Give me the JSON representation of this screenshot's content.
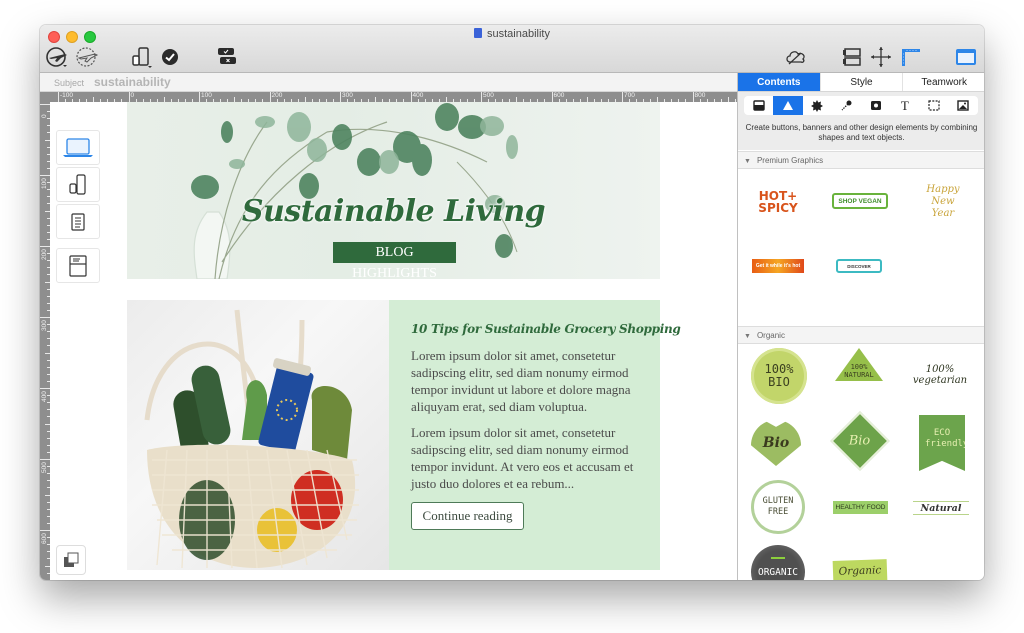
{
  "window": {
    "title": "sustainability",
    "title_icon": "document-icon"
  },
  "toolbar": {
    "left_icons": [
      "publish-icon",
      "publish-preview-icon",
      "device-preview-icon",
      "check-icon",
      "approval-icon"
    ],
    "right_icons": [
      "cloud-icon",
      "layout-icon",
      "move-arrows-icon",
      "ruler-icon",
      "sidebar-toggle-icon"
    ]
  },
  "subject": {
    "label": "Subject",
    "value": "sustainability"
  },
  "ruler": {
    "horizontal_labels": [
      "-100",
      "0",
      "100",
      "200",
      "300",
      "400",
      "500",
      "600",
      "700",
      "800"
    ],
    "vertical_labels": [
      "0",
      "100",
      "200",
      "300",
      "400",
      "500",
      "600"
    ]
  },
  "device_buttons": [
    {
      "name": "desktop",
      "icon": "laptop-icon"
    },
    {
      "name": "mobile",
      "icon": "phone-watch-icon"
    },
    {
      "name": "plain-text",
      "icon": "text-document-icon"
    },
    {
      "name": "email-header",
      "icon": "email-window-icon"
    }
  ],
  "banner": {
    "title": "Sustainable Living",
    "subtitle": "BLOG HIGHLIGHTS"
  },
  "article": {
    "title": "10 Tips for Sustainable Grocery Shopping",
    "paragraph1": "Lorem ipsum dolor sit amet, consetetur sadipscing elitr, sed diam nonumy eirmod tempor invidunt ut labore et dolore magna aliquyam erat, sed diam voluptua.",
    "paragraph2": "Lorem ipsum dolor sit amet, consetetur sadipscing elitr, sed diam nonumy eirmod tempor invidunt. At vero eos et accusam et justo duo dolores et ea rebum...",
    "button": "Continue reading"
  },
  "sidebar": {
    "tabs": [
      {
        "label": "Contents",
        "active": true
      },
      {
        "label": "Style",
        "active": false
      },
      {
        "label": "Teamwork",
        "active": false
      }
    ],
    "tools": [
      "layout-block-icon",
      "shape-icon",
      "badge-icon",
      "pipette-icon",
      "button-icon",
      "text-icon",
      "selection-icon",
      "image-icon"
    ],
    "active_tool": 1,
    "tool_description": "Create buttons, banners and other design elements by combining shapes and text objects.",
    "sections": [
      {
        "title": "Premium Graphics",
        "items": [
          {
            "label": "HOT+ SPICY"
          },
          {
            "label": "SHOP VEGAN"
          },
          {
            "label": "Happy New Year"
          },
          {
            "label": "Get it while it's hot"
          },
          {
            "label": "DISCOVER"
          }
        ]
      },
      {
        "title": "Organic",
        "items": [
          {
            "label": "100% BIO"
          },
          {
            "label": "100% NATURAL"
          },
          {
            "label": "100% vegetarian"
          },
          {
            "label": "Bio"
          },
          {
            "label": "Bio"
          },
          {
            "label": "ECO friendly"
          },
          {
            "label": "GLUTEN FREE"
          },
          {
            "label": "HEALTHY FOOD"
          },
          {
            "label": "Natural"
          },
          {
            "label": "ORGANIC"
          },
          {
            "label": "Organic"
          }
        ]
      }
    ]
  },
  "colors": {
    "accent": "#1a73e8",
    "brand_green": "#2f6a3c",
    "article_bg": "#d4edd5"
  }
}
